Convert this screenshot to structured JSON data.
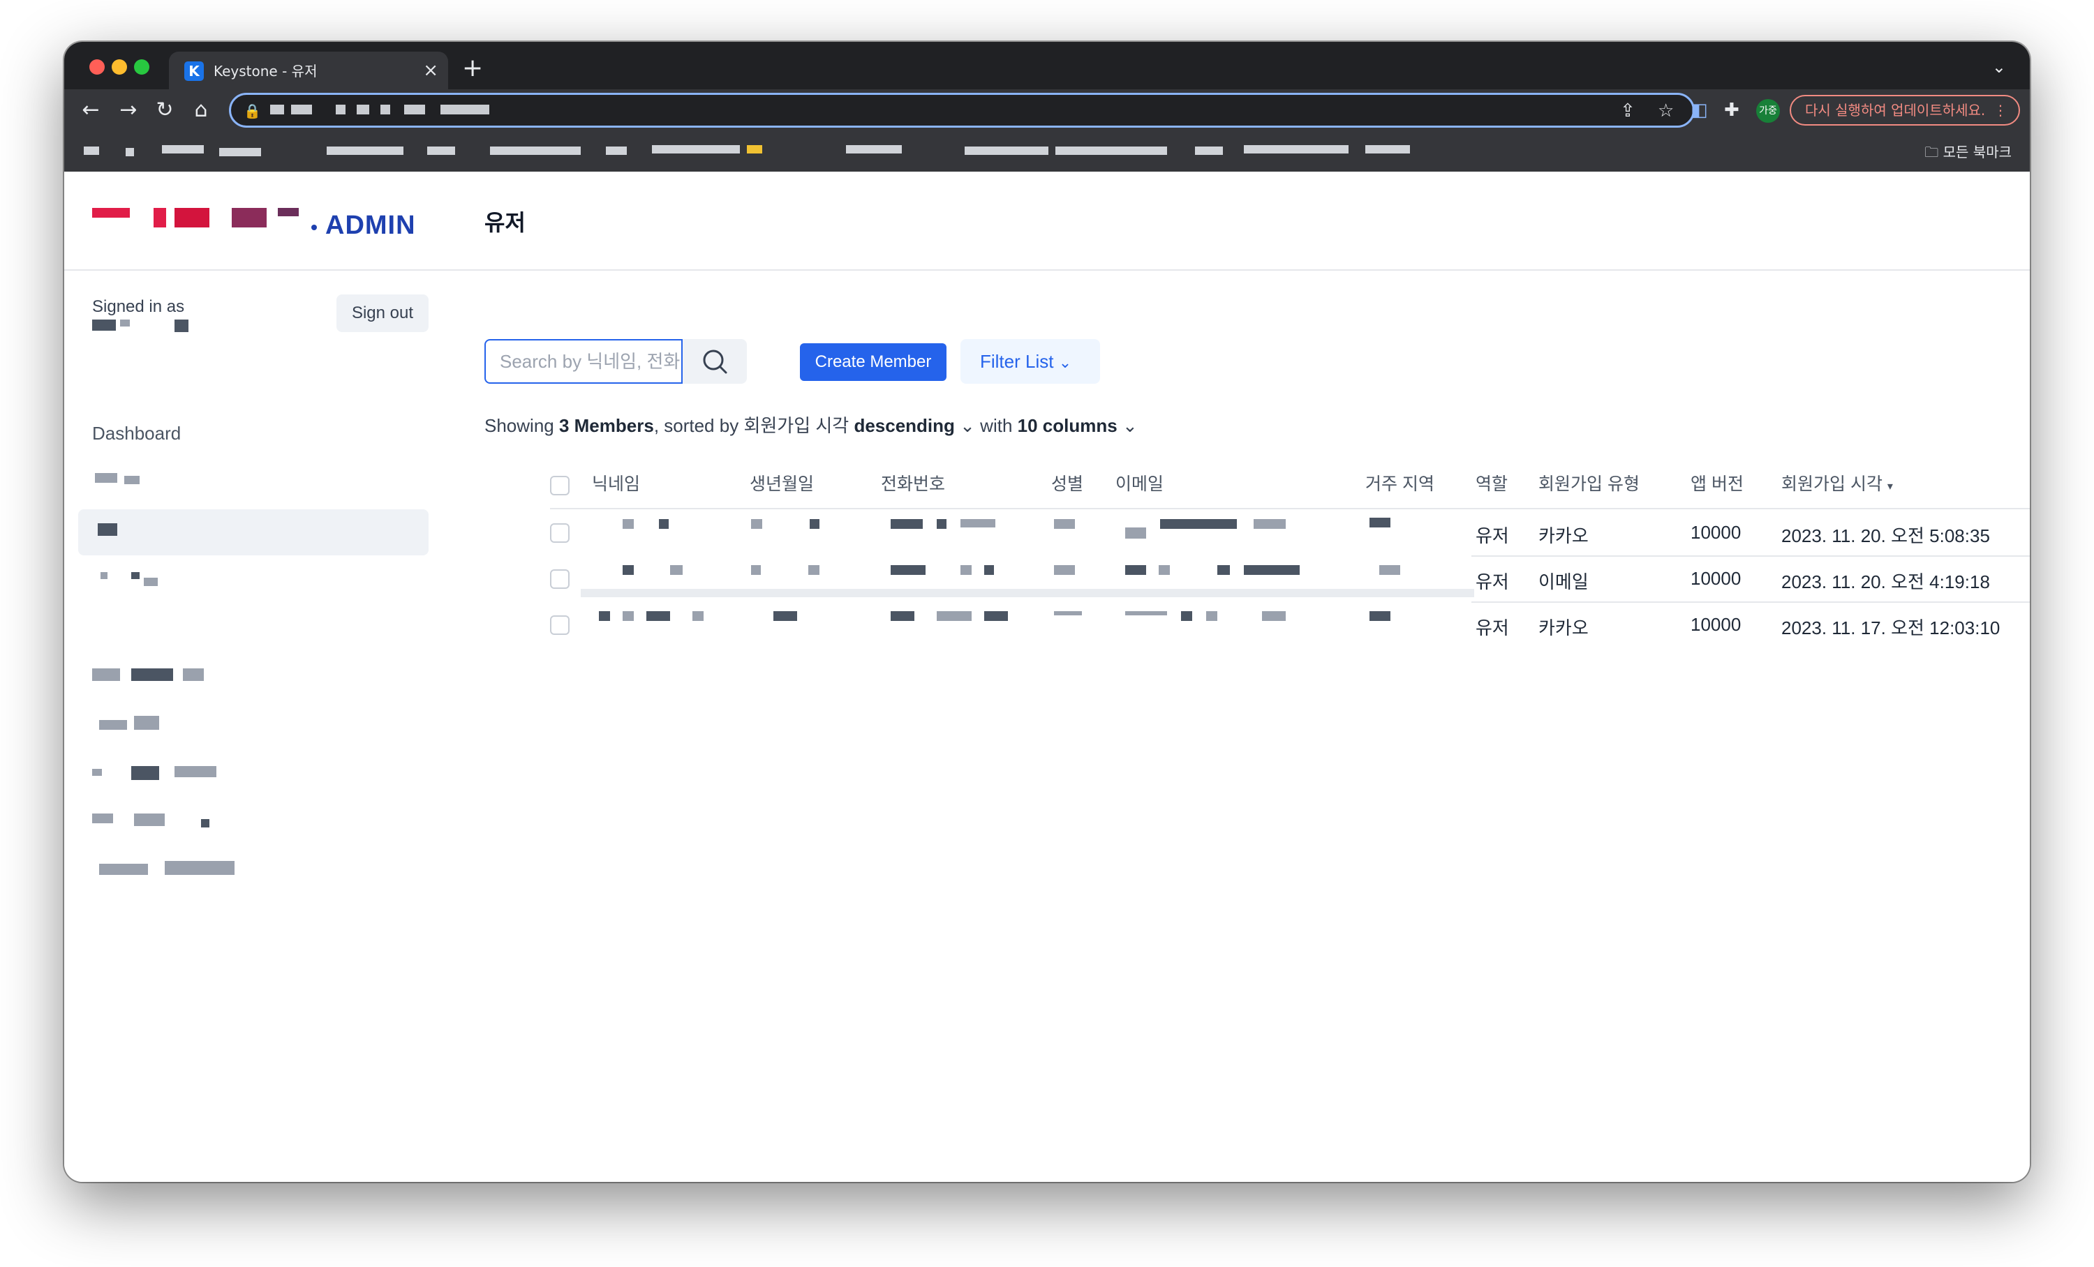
{
  "browser": {
    "tab_title": "Keystone - 유저",
    "tab_favicon_letter": "K",
    "new_tab_glyph": "+",
    "update_button": "다시 실행하여 업데이트하세요.",
    "profile_initials": "가중",
    "all_bookmarks": "모든 북마크"
  },
  "brand": {
    "logo_suffix": "ADMIN"
  },
  "header": {
    "page_title": "유저"
  },
  "sidebar": {
    "signed_in_label": "Signed in as",
    "sign_out": "Sign out",
    "dashboard": "Dashboard"
  },
  "toolbar": {
    "search_placeholder": "Search by 닉네임, 전화번호",
    "create_member": "Create Member",
    "filter_list": "Filter List"
  },
  "list_summary": {
    "prefix": "Showing",
    "count": "3 Members",
    "sorted_by": ", sorted by",
    "sort_field": "회원가입 시각",
    "sort_direction": "descending",
    "with": "with",
    "columns": "10 columns"
  },
  "table": {
    "columns": [
      "닉네임",
      "생년월일",
      "전화번호",
      "성별",
      "이메일",
      "거주 지역",
      "역할",
      "회원가입 유형",
      "앱 버전",
      "회원가입 시각"
    ],
    "sorted_column_index": 9,
    "rows": [
      {
        "role": "유저",
        "signup_type": "카카오",
        "app_version": "10000",
        "signup_time": "2023. 11. 20. 오전 5:08:35"
      },
      {
        "role": "유저",
        "signup_type": "이메일",
        "app_version": "10000",
        "signup_time": "2023. 11. 20. 오전 4:19:18"
      },
      {
        "role": "유저",
        "signup_type": "카카오",
        "app_version": "10000",
        "signup_time": "2023. 11. 17. 오전 12:03:10"
      }
    ]
  },
  "colors": {
    "accent": "#2563eb",
    "logo_primary": "#1e40af",
    "brand_red": "#e11d48",
    "brand_maroon": "#8b2c5a"
  }
}
